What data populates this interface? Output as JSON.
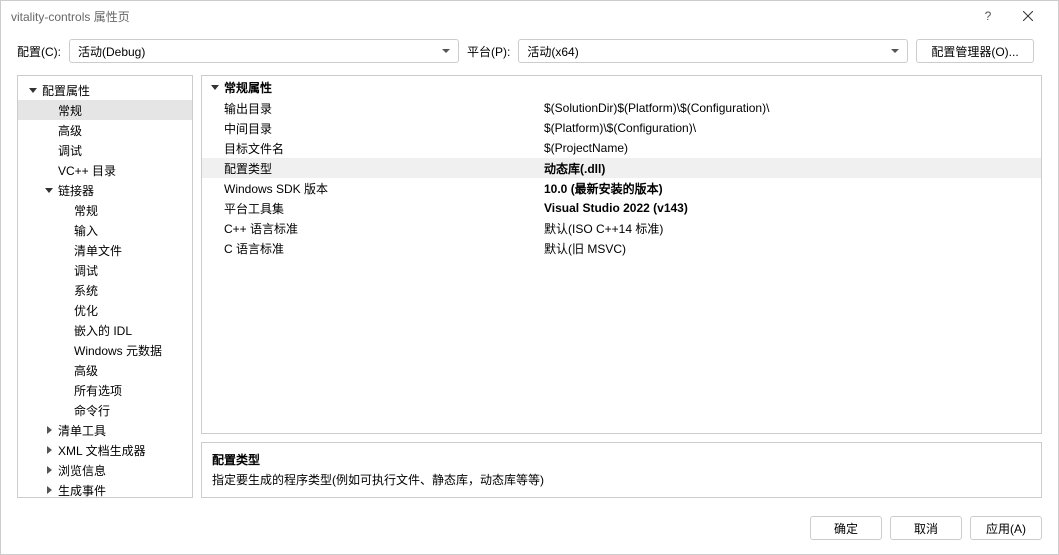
{
  "title": "vitality-controls 属性页",
  "toolbar": {
    "config_label": "配置(C):",
    "config_value": "活动(Debug)",
    "platform_label": "平台(P):",
    "platform_value": "活动(x64)",
    "manager_label": "配置管理器(O)..."
  },
  "tree": {
    "root": "配置属性",
    "items": [
      "常规",
      "高级",
      "调试",
      "VC++ 目录"
    ],
    "linker": "链接器",
    "linker_items": [
      "常规",
      "输入",
      "清单文件",
      "调试",
      "系统",
      "优化",
      "嵌入的 IDL",
      "Windows 元数据",
      "高级",
      "所有选项",
      "命令行"
    ],
    "tail": [
      "清单工具",
      "XML 文档生成器",
      "浏览信息",
      "生成事件"
    ]
  },
  "grid": {
    "header": "常规属性",
    "rows": [
      {
        "k": "输出目录",
        "v": "$(SolutionDir)$(Platform)\\$(Configuration)\\",
        "bold": false
      },
      {
        "k": "中间目录",
        "v": "$(Platform)\\$(Configuration)\\",
        "bold": false
      },
      {
        "k": "目标文件名",
        "v": "$(ProjectName)",
        "bold": false
      },
      {
        "k": "配置类型",
        "v": "动态库(.dll)",
        "bold": true,
        "selected": true
      },
      {
        "k": "Windows SDK 版本",
        "v": "10.0 (最新安装的版本)",
        "bold": true
      },
      {
        "k": "平台工具集",
        "v": "Visual Studio 2022 (v143)",
        "bold": true
      },
      {
        "k": "C++ 语言标准",
        "v": "默认(ISO C++14 标准)",
        "bold": false
      },
      {
        "k": "C 语言标准",
        "v": "默认(旧 MSVC)",
        "bold": false
      }
    ]
  },
  "desc": {
    "title": "配置类型",
    "text": "指定要生成的程序类型(例如可执行文件、静态库，动态库等等)"
  },
  "footer": {
    "ok": "确定",
    "cancel": "取消",
    "apply": "应用(A)"
  }
}
